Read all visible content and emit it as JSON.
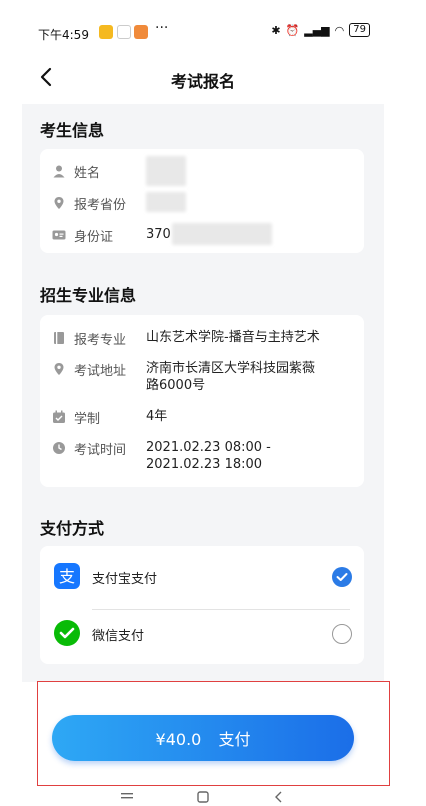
{
  "status_bar": {
    "time": "下午4:59",
    "battery": "79"
  },
  "header": {
    "title": "考试报名"
  },
  "candidate": {
    "section_title": "考生信息",
    "name_label": "姓名",
    "province_label": "报考省份",
    "id_label": "身份证",
    "id_value_prefix": "370"
  },
  "major": {
    "section_title": "招生专业信息",
    "items": [
      {
        "label": "报考专业",
        "value": "山东艺术学院-播音与主持艺术",
        "icon": "book-icon"
      },
      {
        "label": "考试地址",
        "value": "济南市长清区大学科技园紫薇路6000号",
        "icon": "location-icon"
      },
      {
        "label": "学制",
        "value": "4年",
        "icon": "calendar-icon"
      },
      {
        "label": "考试时间",
        "value": "2021.02.23 08:00 - 2021.02.23 18:00",
        "icon": "clock-icon"
      }
    ]
  },
  "payment": {
    "section_title": "支付方式",
    "options": [
      {
        "label": "支付宝支付",
        "selected": true,
        "icon": "alipay-icon",
        "color": "#1677ff"
      },
      {
        "label": "微信支付",
        "selected": false,
        "icon": "wechat-pay-icon",
        "color": "#09bb07"
      }
    ]
  },
  "footer": {
    "amount": "¥40.0",
    "pay_label": "支付",
    "button_gradient": [
      "#2ea8f5",
      "#1b6ee8"
    ]
  }
}
